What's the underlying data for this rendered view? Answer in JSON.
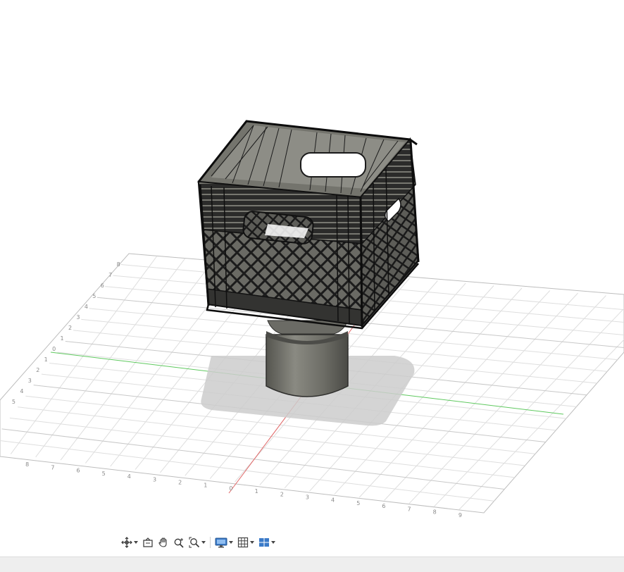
{
  "viewport": {
    "model_name": "milk crate on cylinder",
    "grid_tick_labels_left": [
      "8",
      "7",
      "6",
      "5",
      "4",
      "3",
      "2",
      "1",
      "0",
      "1",
      "2",
      "3",
      "4",
      "5"
    ],
    "grid_tick_labels_bottom": [
      "8",
      "7",
      "6",
      "5",
      "4",
      "3",
      "2",
      "1",
      "0",
      "1",
      "2",
      "3",
      "4",
      "5",
      "6",
      "7",
      "8",
      "9"
    ],
    "colors": {
      "x_axis": "#e06666",
      "y_axis": "#5fc95f",
      "grid": "#d6d6d6",
      "model": "#4a4a46",
      "shadow": "#cfcfcf"
    }
  },
  "toolbar": {
    "items": [
      {
        "name": "orbit-icon",
        "has_dropdown": true
      },
      {
        "name": "look-at-icon",
        "has_dropdown": false
      },
      {
        "name": "pan-icon",
        "has_dropdown": false
      },
      {
        "name": "zoom-icon",
        "has_dropdown": false
      },
      {
        "name": "fit-icon",
        "has_dropdown": true
      },
      {
        "name": "display-settings-icon",
        "has_dropdown": true
      },
      {
        "name": "grid-settings-icon",
        "has_dropdown": true
      },
      {
        "name": "viewports-icon",
        "has_dropdown": true
      }
    ]
  },
  "statusbar": {
    "text": ""
  }
}
